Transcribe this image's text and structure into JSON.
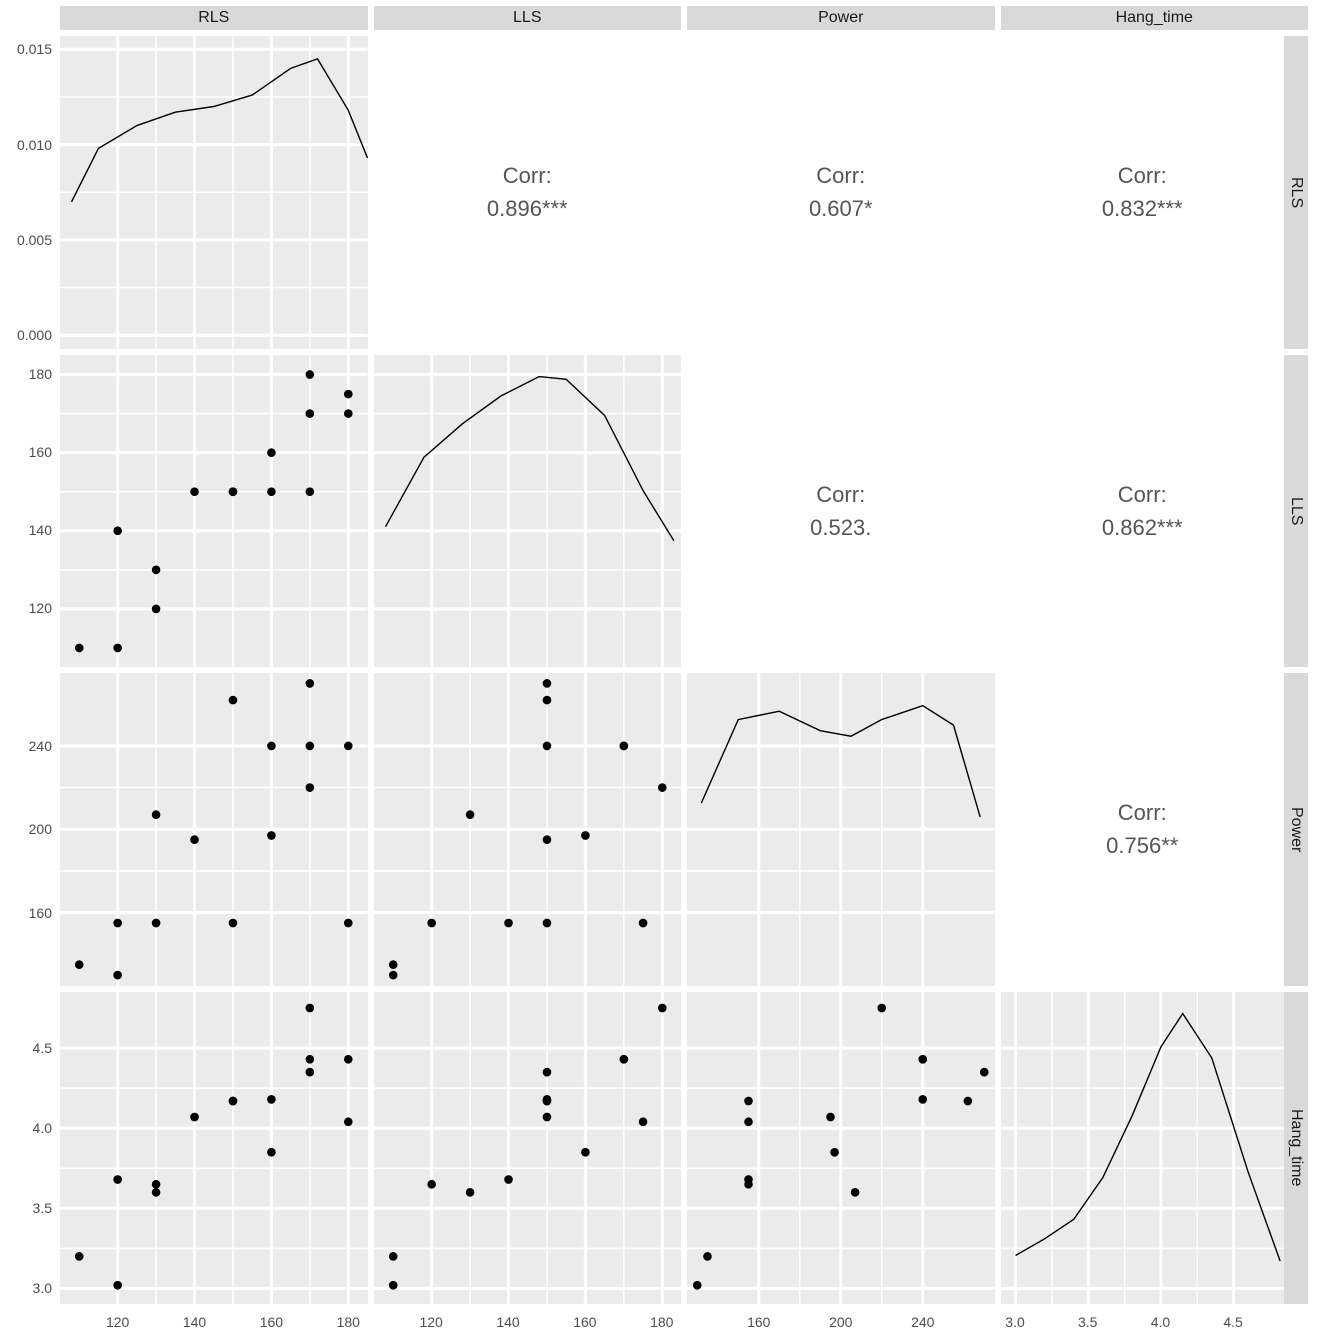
{
  "variables": [
    "RLS",
    "LLS",
    "Power",
    "Hang_time"
  ],
  "chart_data": {
    "type": "scatter_matrix",
    "variables": [
      "RLS",
      "LLS",
      "Power",
      "Hang_time"
    ],
    "correlations": {
      "RLS_LLS": {
        "label": "Corr:",
        "value": "0.896***"
      },
      "RLS_Power": {
        "label": "Corr:",
        "value": "0.607*"
      },
      "RLS_Hang_time": {
        "label": "Corr:",
        "value": "0.832***"
      },
      "LLS_Power": {
        "label": "Corr:",
        "value": "0.523."
      },
      "LLS_Hang_time": {
        "label": "Corr:",
        "value": "0.862***"
      },
      "Power_Hang_time": {
        "label": "Corr:",
        "value": "0.756**"
      }
    },
    "axes": {
      "RLS": {
        "ticks": [
          120,
          140,
          160,
          180
        ],
        "range": [
          105,
          185
        ]
      },
      "LLS": {
        "ticks": [
          120,
          140,
          160,
          180
        ],
        "range": [
          105,
          185
        ]
      },
      "Power": {
        "ticks": [
          160,
          200,
          240
        ],
        "range": [
          125,
          275
        ]
      },
      "Hang_time": {
        "ticks": [
          3.0,
          3.5,
          4.0,
          4.5
        ],
        "range": [
          2.9,
          4.85
        ]
      },
      "density_RLS": {
        "ticks": [
          0.0,
          0.005,
          0.01,
          0.015
        ],
        "range": [
          -0.0007,
          0.0157
        ]
      }
    },
    "raw_points": {
      "RLS": [
        110,
        120,
        120,
        130,
        130,
        140,
        150,
        150,
        160,
        160,
        170,
        170,
        170,
        180,
        180
      ],
      "LLS": [
        110,
        110,
        140,
        120,
        130,
        150,
        150,
        150,
        150,
        160,
        150,
        170,
        180,
        170,
        175
      ],
      "Power": [
        135,
        130,
        155,
        155,
        207,
        195,
        155,
        262,
        240,
        197,
        270,
        240,
        220,
        240,
        155
      ],
      "Hang_time": [
        3.2,
        3.02,
        3.68,
        3.65,
        3.6,
        4.07,
        4.17,
        4.17,
        4.18,
        3.85,
        4.35,
        4.43,
        4.75,
        4.43,
        4.04
      ]
    },
    "density_curves": {
      "RLS": {
        "x": [
          108,
          115,
          125,
          135,
          145,
          155,
          165,
          172,
          180,
          185
        ],
        "y": [
          0.007,
          0.0098,
          0.011,
          0.0117,
          0.012,
          0.0126,
          0.014,
          0.0145,
          0.0118,
          0.0093
        ]
      },
      "LLS": {
        "x": [
          108,
          118,
          128,
          138,
          148,
          155,
          165,
          175,
          183
        ],
        "y_norm": [
          0.45,
          0.7,
          0.82,
          0.92,
          0.99,
          0.98,
          0.85,
          0.58,
          0.4
        ]
      },
      "Power": {
        "x": [
          132,
          150,
          170,
          190,
          205,
          220,
          240,
          255,
          268
        ],
        "y_norm": [
          0.6,
          0.9,
          0.93,
          0.86,
          0.84,
          0.9,
          0.95,
          0.88,
          0.55
        ]
      },
      "Hang_time": {
        "x": [
          3.0,
          3.2,
          3.4,
          3.6,
          3.8,
          4.0,
          4.15,
          4.35,
          4.6,
          4.82
        ],
        "y_norm": [
          0.12,
          0.18,
          0.25,
          0.4,
          0.62,
          0.87,
          0.99,
          0.83,
          0.42,
          0.1
        ]
      }
    }
  }
}
